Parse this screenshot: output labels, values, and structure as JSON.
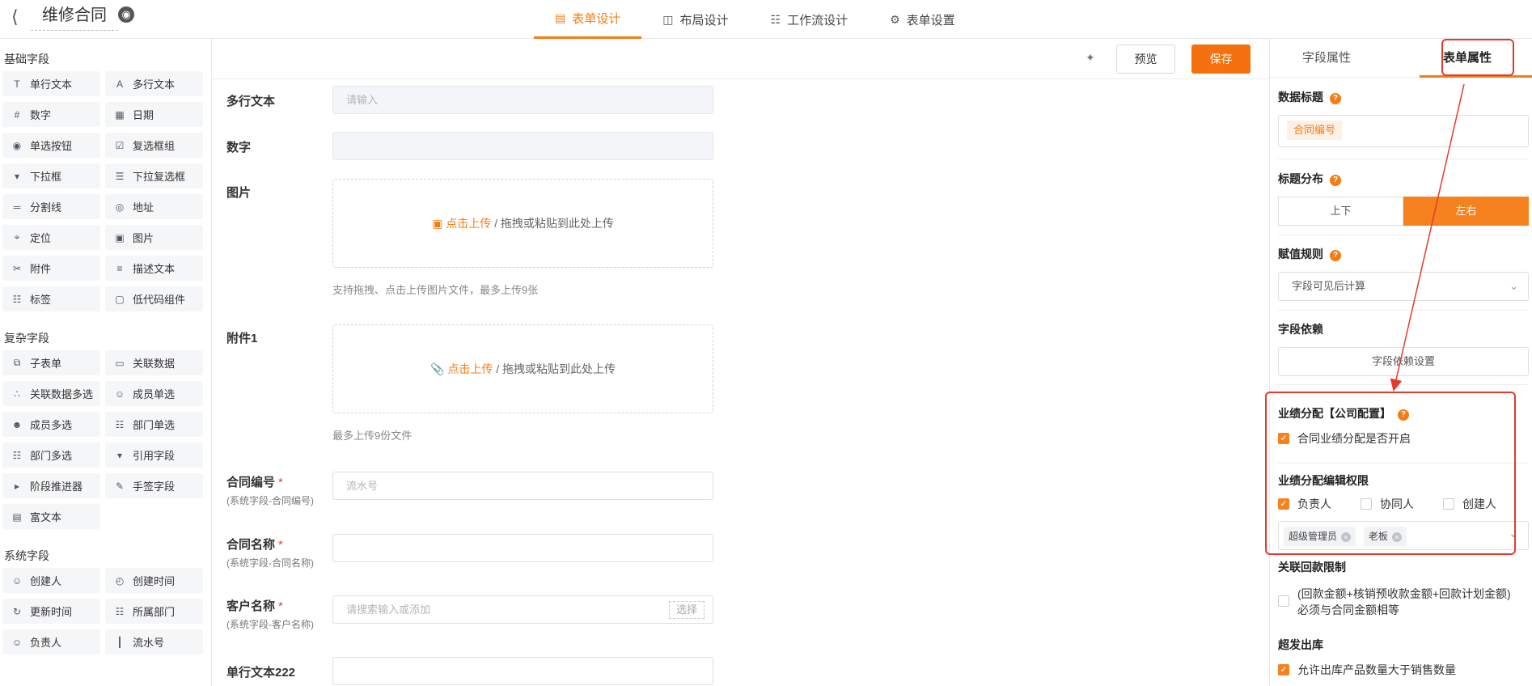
{
  "header": {
    "title": "维修合同",
    "tabs": [
      {
        "label": "表单设计",
        "icon": "form-icon",
        "active": true
      },
      {
        "label": "布局设计",
        "icon": "layout-icon",
        "active": false
      },
      {
        "label": "工作流设计",
        "icon": "workflow-icon",
        "active": false
      },
      {
        "label": "表单设置",
        "icon": "gear-icon",
        "active": false
      }
    ]
  },
  "left_panel": {
    "basic_title": "基础字段",
    "basic_fields": [
      "单行文本",
      "多行文本",
      "数字",
      "日期",
      "单选按钮",
      "复选框组",
      "下拉框",
      "下拉复选框",
      "分割线",
      "地址",
      "定位",
      "图片",
      "附件",
      "描述文本",
      "标签",
      "低代码组件"
    ],
    "complex_title": "复杂字段",
    "complex_fields": [
      "子表单",
      "关联数据",
      "关联数据多选",
      "成员单选",
      "成员多选",
      "部门单选",
      "部门多选",
      "引用字段",
      "阶段推进器",
      "手签字段",
      "富文本"
    ],
    "system_title": "系统字段",
    "system_fields": [
      "创建人",
      "创建时间",
      "更新时间",
      "所属部门",
      "负责人",
      "流水号"
    ]
  },
  "toolbar": {
    "preview_label": "预览",
    "save_label": "保存"
  },
  "form": {
    "multiline": {
      "label": "多行文本",
      "placeholder": "请输入"
    },
    "number": {
      "label": "数字"
    },
    "image": {
      "label": "图片",
      "upload_link": "点击上传",
      "upload_rest": " / 拖拽或粘贴到此处上传",
      "hint": "支持拖拽、点击上传图片文件，最多上传9张"
    },
    "attachment": {
      "label": "附件1",
      "upload_link": "点击上传",
      "upload_rest": " / 拖拽或粘贴到此处上传",
      "hint": "最多上传9份文件"
    },
    "contract_no": {
      "label": "合同编号",
      "req": "*",
      "sub": "(系统字段-合同编号)",
      "placeholder": "流水号"
    },
    "contract_name": {
      "label": "合同名称",
      "req": "*",
      "sub": "(系统字段-合同名称)"
    },
    "customer": {
      "label": "客户名称",
      "req": "*",
      "sub": "(系统字段-客户名称)",
      "placeholder": "请搜索输入或添加",
      "select_label": "选择"
    },
    "single_text": {
      "label": "单行文本222"
    }
  },
  "right_panel": {
    "tabs": [
      "字段属性",
      "表单属性"
    ],
    "data_title": {
      "label": "数据标题",
      "tag": "合同编号"
    },
    "title_layout": {
      "label": "标题分布",
      "options": [
        "上下",
        "左右"
      ],
      "selected": "左右"
    },
    "assign_rule": {
      "label": "赋值规则",
      "value": "字段可见后计算"
    },
    "field_dependency": {
      "label": "字段依赖",
      "button": "字段依赖设置"
    },
    "performance": {
      "label": "业绩分配【公司配置】",
      "enable_label": "合同业绩分配是否开启",
      "enabled": true
    },
    "edit_permission": {
      "label": "业绩分配编辑权限",
      "options": [
        {
          "label": "负责人",
          "checked": true
        },
        {
          "label": "协同人",
          "checked": false
        },
        {
          "label": "创建人",
          "checked": false
        }
      ],
      "roles": [
        "超级管理员",
        "老板"
      ]
    },
    "payment_limit": {
      "label": "关联回款限制",
      "text": "(回款金额+核销预收款金额+回款计划金额)必须与合同金额相等",
      "checked": false
    },
    "over_outbound": {
      "label": "超发出库",
      "text": "允许出库产品数量大于销售数量",
      "checked": true
    }
  },
  "colors": {
    "accent": "#f57c14",
    "highlight": "#e23b2e"
  }
}
